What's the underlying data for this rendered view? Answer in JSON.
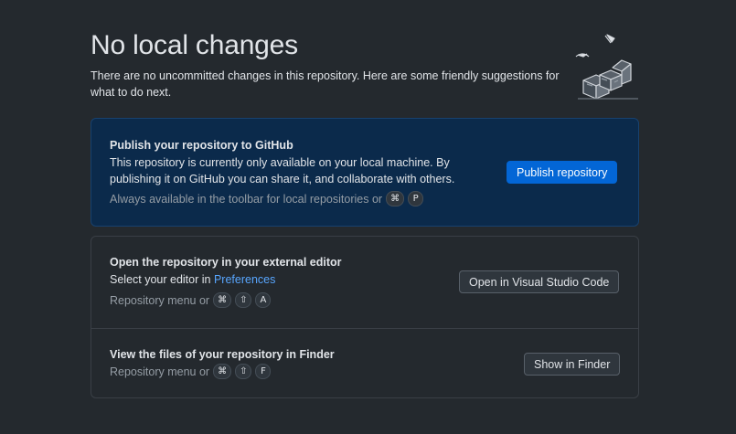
{
  "header": {
    "title": "No local changes",
    "subtitle": "There are no uncommitted changes in this repository. Here are some friendly suggestions for what to do next."
  },
  "publish": {
    "title": "Publish your repository to GitHub",
    "description_line1": "This repository is currently only available on your local machine. By",
    "description_line2": "publishing it on GitHub you can share it, and collaborate with others.",
    "hint": "Always available in the toolbar for local repositories or",
    "keys": [
      "⌘",
      "P"
    ],
    "button": "Publish repository"
  },
  "editor": {
    "title": "Open the repository in your external editor",
    "description_prefix": "Select your editor in",
    "description_link": "Preferences",
    "hint": "Repository menu or",
    "keys": [
      "⌘",
      "⇧",
      "A"
    ],
    "button": "Open in Visual Studio Code"
  },
  "finder": {
    "title": "View the files of your repository in Finder",
    "hint": "Repository menu or",
    "keys": [
      "⌘",
      "⇧",
      "F"
    ],
    "button": "Show in Finder"
  },
  "icons": {
    "illustration": "empty-boxes-illustration"
  },
  "colors": {
    "background": "#24292e",
    "publish_card": "#0b2a4b",
    "primary_button": "#0366d6",
    "link": "#58a6ff"
  }
}
